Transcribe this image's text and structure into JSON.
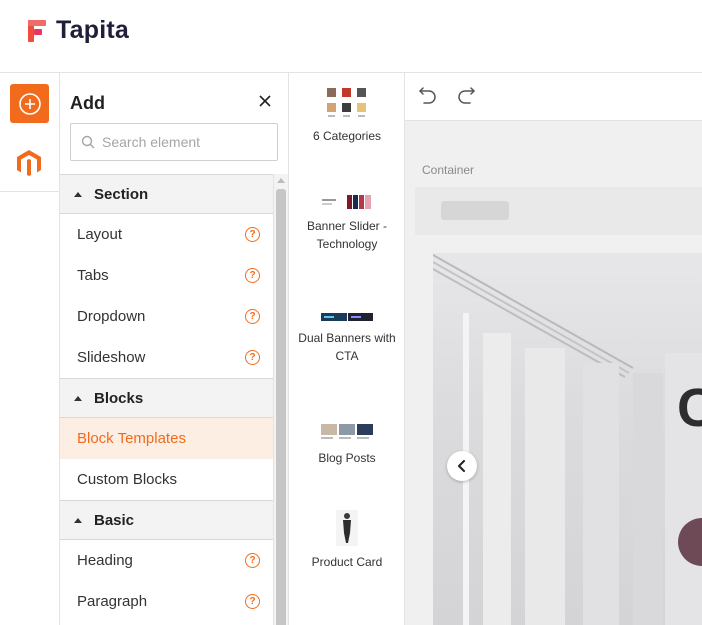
{
  "app": {
    "name": "Tapita"
  },
  "panel": {
    "title": "Add",
    "search_placeholder": "Search element",
    "sections": [
      {
        "label": "Section",
        "items": [
          {
            "label": "Layout",
            "help": "?"
          },
          {
            "label": "Tabs",
            "help": "?"
          },
          {
            "label": "Dropdown",
            "help": "?"
          },
          {
            "label": "Slideshow",
            "help": "?"
          }
        ]
      },
      {
        "label": "Blocks",
        "items": [
          {
            "label": "Block Templates",
            "active": true
          },
          {
            "label": "Custom Blocks"
          }
        ]
      },
      {
        "label": "Basic",
        "items": [
          {
            "label": "Heading",
            "help": "?"
          },
          {
            "label": "Paragraph",
            "help": "?"
          }
        ]
      }
    ]
  },
  "templates": [
    {
      "label": "6 Categories"
    },
    {
      "label": "Banner Slider - Technology"
    },
    {
      "label": "Dual Banners with CTA"
    },
    {
      "label": "Blog Posts"
    },
    {
      "label": "Product Card"
    }
  ],
  "canvas": {
    "container_label": "Container"
  },
  "colors": {
    "accent": "#f26b1d",
    "brand_dark": "#1f1f3a"
  }
}
